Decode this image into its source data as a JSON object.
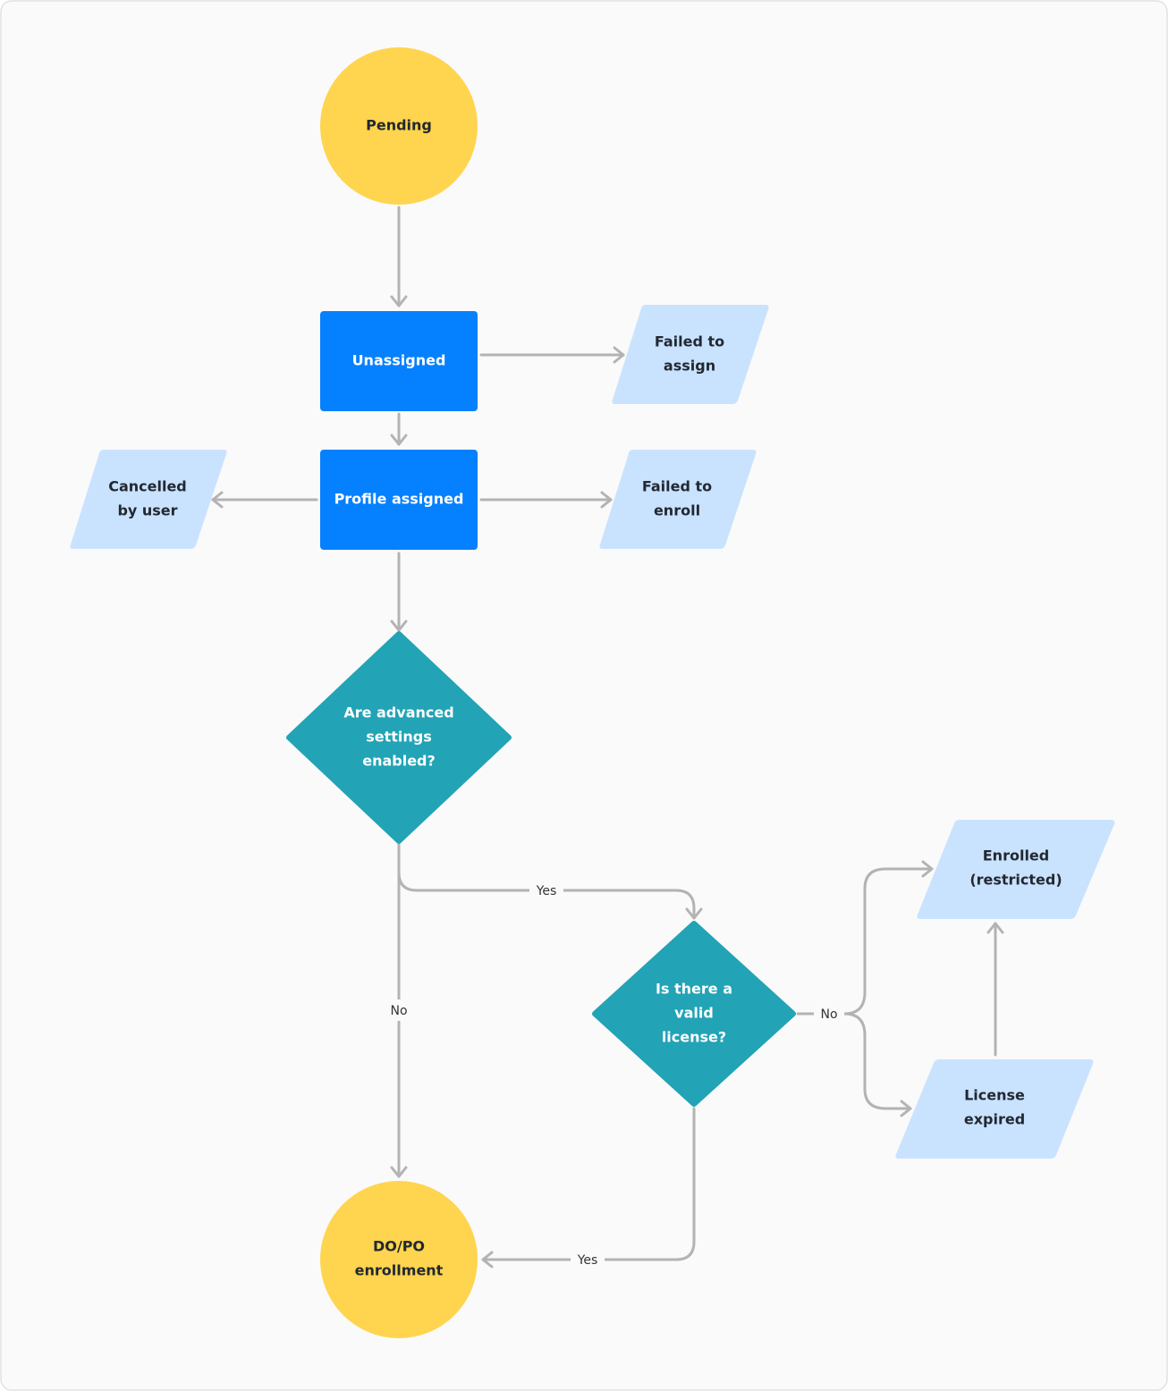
{
  "colors": {
    "terminal": "#FFD44F",
    "process": "#0580FF",
    "decision": "#22A3B6",
    "outcome": "#C9E3FF",
    "connector": "#B3B3B3",
    "background": "#FAFAFA"
  },
  "nodes": {
    "pending": {
      "lines": [
        "Pending"
      ],
      "shape": "circle"
    },
    "unassigned": {
      "lines": [
        "Unassigned"
      ],
      "shape": "rectangle"
    },
    "failed_assign": {
      "lines": [
        "Failed to",
        "assign"
      ],
      "shape": "parallelogram"
    },
    "profile_assigned": {
      "lines": [
        "Profile assigned"
      ],
      "shape": "rectangle"
    },
    "failed_enroll": {
      "lines": [
        "Failed to",
        "enroll"
      ],
      "shape": "parallelogram"
    },
    "cancelled": {
      "lines": [
        "Cancelled",
        "by user"
      ],
      "shape": "parallelogram"
    },
    "advanced": {
      "lines": [
        "Are advanced",
        "settings",
        "enabled?"
      ],
      "shape": "diamond"
    },
    "license": {
      "lines": [
        "Is there a",
        "valid",
        "license?"
      ],
      "shape": "diamond"
    },
    "enrolled_restricted": {
      "lines": [
        "Enrolled",
        "(restricted)"
      ],
      "shape": "parallelogram"
    },
    "license_expired": {
      "lines": [
        "License",
        "expired"
      ],
      "shape": "parallelogram"
    },
    "dopo": {
      "lines": [
        "DO/PO",
        "enrollment"
      ],
      "shape": "circle"
    }
  },
  "edges": {
    "advanced_yes": "Yes",
    "advanced_no": "No",
    "license_no": "No",
    "license_yes": "Yes"
  }
}
